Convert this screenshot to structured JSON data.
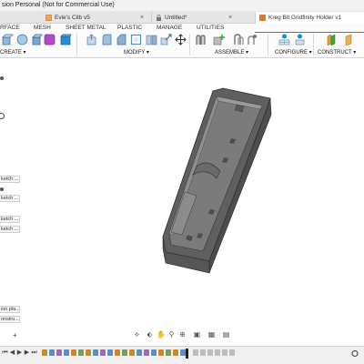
{
  "window": {
    "title": "sion Personal (Not for Commercial Use)"
  },
  "tabs": [
    {
      "label": "Evie's Cilb v5",
      "close": "×"
    },
    {
      "label": "Untitled*",
      "close": "×"
    },
    {
      "label": "Kreg Bit Gridfinity Holder v1"
    }
  ],
  "ribbon": {
    "tabs": [
      "RFACE",
      "MESH",
      "SHEET METAL",
      "PLASTIC",
      "MANAGE",
      "UTILITIES"
    ],
    "groups": {
      "create": "CREATE ▾",
      "modify": "MODIFY ▾",
      "assemble": "ASSEMBLE ▾",
      "configure": "CONFIGURE ▾",
      "construct": "CONSTRUCT ▾"
    }
  },
  "browser": {
    "items": [
      "ketch ...",
      "ketch ...",
      "ketch ...",
      "ketch ...",
      "ion pla...",
      "onstru..."
    ],
    "add": "+"
  },
  "colors": {
    "accent": "#0696d7",
    "model_body": "#6d6d6d",
    "active_tab_icon": "#e87722"
  },
  "icons": {
    "nav": [
      "orbit-icon",
      "pan-icon",
      "look-at-icon",
      "zoom-icon",
      "fit-icon",
      "display-icon",
      "grid-icon",
      "viewports-icon"
    ],
    "timeline": [
      "first-icon",
      "prev-icon",
      "play-icon",
      "next-icon",
      "last-icon"
    ]
  }
}
